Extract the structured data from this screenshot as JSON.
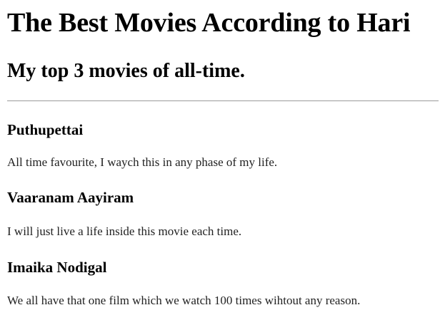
{
  "header": {
    "title": "The Best Movies According to Hari",
    "subtitle": "My top 3 movies of all-time."
  },
  "movies": [
    {
      "title": "Puthupettai",
      "description": "All time favourite, I waych this in any phase of my life."
    },
    {
      "title": "Vaaranam Aayiram",
      "description": "I will just live a life inside this movie each time."
    },
    {
      "title": "Imaika Nodigal",
      "description": "We all have that one film which we watch 100 times wihtout any reason."
    }
  ]
}
